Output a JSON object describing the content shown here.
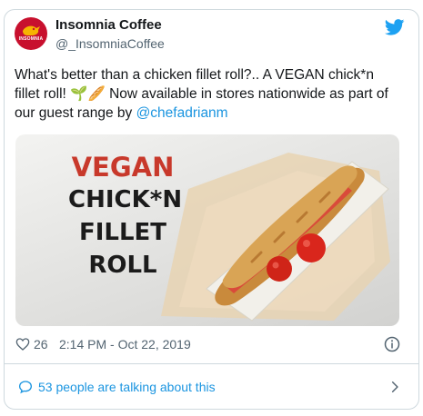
{
  "account": {
    "display_name": "Insomnia Coffee",
    "handle": "@_InsomniaCoffee",
    "avatar_text": "INSOMNIA",
    "brand_color": "#c8102e",
    "avatar_icon": "bird-logo-icon"
  },
  "tweet": {
    "text_before": "What's better than a chicken fillet roll?.. A VEGAN chick*n fillet roll! ",
    "emoji": "🌱🥖",
    "text_after": " Now available in stores nationwide as part of our guest range by ",
    "mention": "@chefadrianm",
    "link_color": "#1b95e0"
  },
  "media": {
    "headline_line1": "VEGAN",
    "headline_line2": "CHICK*N",
    "headline_line3": "FILLET",
    "headline_line4": "ROLL",
    "headline_accent": "#c8392b"
  },
  "stats": {
    "likes": "26",
    "timestamp": "2:14 PM - Oct 22, 2019"
  },
  "talking": {
    "label": "53 people are talking about this"
  },
  "icons": {
    "platform": "twitter-bird-icon",
    "like": "heart-icon",
    "info": "info-icon",
    "reply": "speech-bubble-icon",
    "more": "chevron-right-icon"
  }
}
